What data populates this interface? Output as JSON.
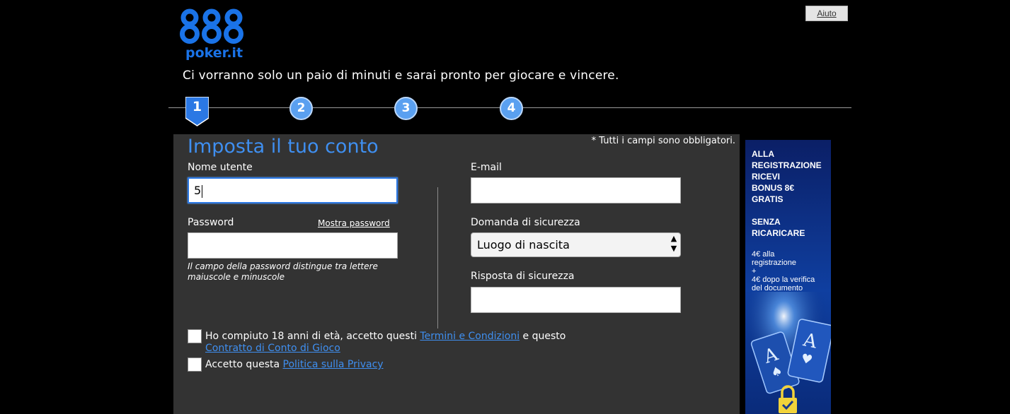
{
  "brand": {
    "logo_text": "poker.it",
    "logo_mark": "888"
  },
  "header": {
    "help_label": "Aiuto",
    "tagline": "Ci vorranno solo un paio di minuti e sarai pronto per giocare e vincere."
  },
  "steps": {
    "current": "1",
    "items": [
      "2",
      "3",
      "4"
    ]
  },
  "form": {
    "title": "Imposta il tuo conto",
    "required_note": "* Tutti i campi sono obbligatori.",
    "username": {
      "label": "Nome utente",
      "value": "5"
    },
    "password": {
      "label": "Password",
      "value": "",
      "show_label": "Mostra password",
      "hint": "Il campo della password distingue tra lettere maiuscole e minuscole"
    },
    "email": {
      "label": "E-mail",
      "value": ""
    },
    "security_question": {
      "label": "Domanda di sicurezza",
      "selected": "Luogo di nascita"
    },
    "security_answer": {
      "label": "Risposta di sicurezza",
      "value": ""
    },
    "terms": {
      "text_before": "Ho compiuto 18 anni di età, accetto questi ",
      "link1": "Termini e Condizioni",
      "text_middle": " e questo",
      "link2": "Contratto di Conto di Gioco",
      "checked": false
    },
    "privacy": {
      "text_before": "Accetto questa ",
      "link": "Politica sulla Privacy",
      "checked": false
    }
  },
  "promo": {
    "headline": [
      "ALLA",
      "REGISTRAZIONE",
      "RICEVI",
      "BONUS 8€",
      "GRATIS",
      "",
      "SENZA",
      "RICARICARE"
    ],
    "details": [
      "4€ alla",
      "registrazione",
      "+",
      "4€ dopo la verifica",
      "del documento"
    ]
  },
  "colors": {
    "accent": "#3f8ff0",
    "panel": "#333333",
    "step": "#5aa0f0",
    "background": "#000000"
  }
}
